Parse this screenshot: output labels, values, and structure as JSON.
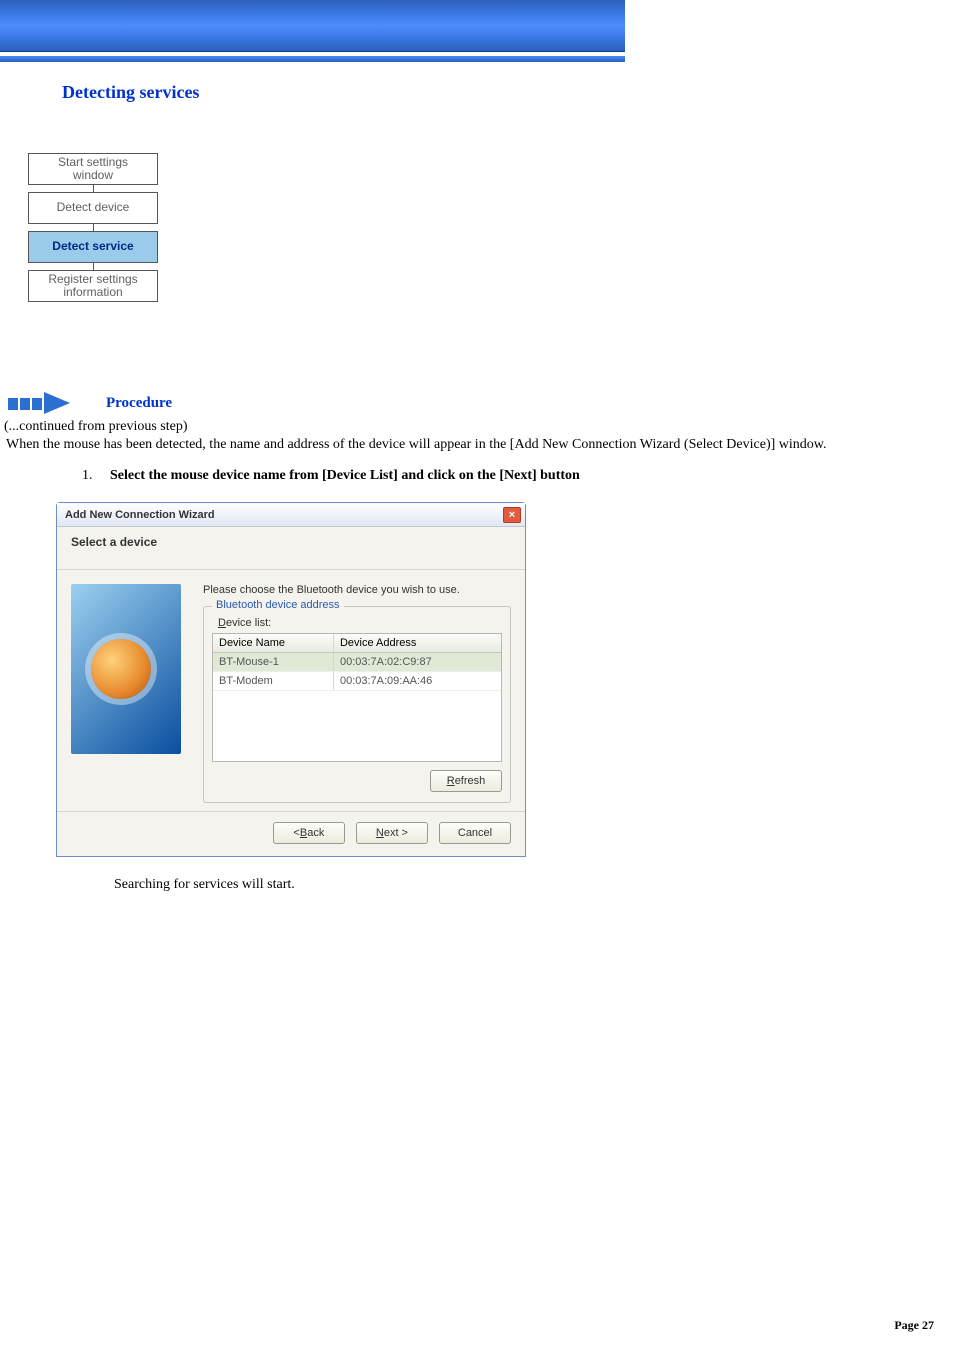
{
  "section_title": "Detecting services",
  "flow": {
    "start": "Start settings\nwindow",
    "detect_device": "Detect device",
    "detect_service": "Detect service",
    "register": "Register settings\ninformation"
  },
  "procedure_label": "Procedure",
  "continued_line": "(...continued from previous step)",
  "intro_line": "When the mouse has been detected, the name and address of the device will appear in the [Add New Connection Wizard (Select Device)] window.",
  "step": {
    "number": "1.",
    "text": "Select the mouse device name from [Device List] and click on the [Next] button"
  },
  "dialog": {
    "title": "Add New Connection Wizard",
    "close_glyph": "×",
    "subtitle": "Select a device",
    "prompt": "Please choose the Bluetooth device you wish to use.",
    "group_label": "Bluetooth device address",
    "list_label_prefix": "",
    "list_label_u": "D",
    "list_label_rest": "evice list:",
    "columns": {
      "name": "Device Name",
      "address": "Device Address"
    },
    "rows": [
      {
        "name": "BT-Mouse-1",
        "address": "00:03:7A:02:C9:87",
        "selected": true
      },
      {
        "name": "BT-Modem",
        "address": "00:03:7A:09:AA:46",
        "selected": false
      }
    ],
    "refresh_u": "R",
    "refresh_rest": "efresh",
    "back_prefix": "< ",
    "back_u": "B",
    "back_rest": "ack",
    "next_u": "N",
    "next_rest": "ext >",
    "cancel": "Cancel"
  },
  "after_text": "Searching for services will start.",
  "footer": {
    "label": "Page",
    "number": "27"
  }
}
